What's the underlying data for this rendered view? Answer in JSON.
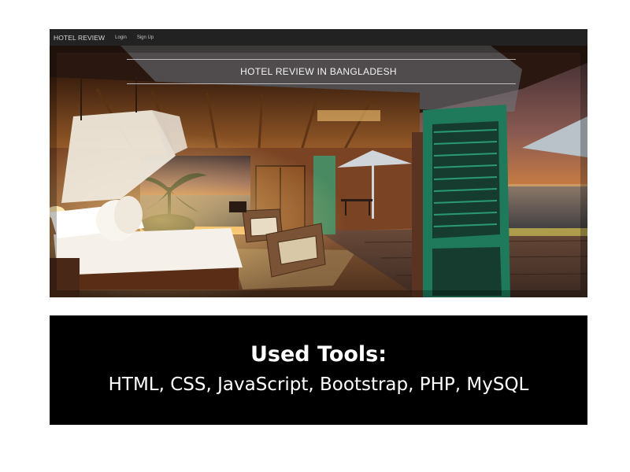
{
  "navbar": {
    "brand": "HOTEL REVIEW",
    "links": [
      "Login",
      "Sign Up"
    ]
  },
  "hero": {
    "title": "HOTEL REVIEW IN BANGLADESH",
    "image_subject": "open-air beach bungalow bedroom at sunset"
  },
  "tools": {
    "heading": "Used Tools:",
    "list": "HTML, CSS, JavaScript, Bootstrap, PHP, MySQL"
  },
  "colors": {
    "navbar_bg": "#222222",
    "panel_bg": "#000000",
    "sunset_orange": "#f2a541",
    "shutter_green": "#1f7a5c"
  }
}
